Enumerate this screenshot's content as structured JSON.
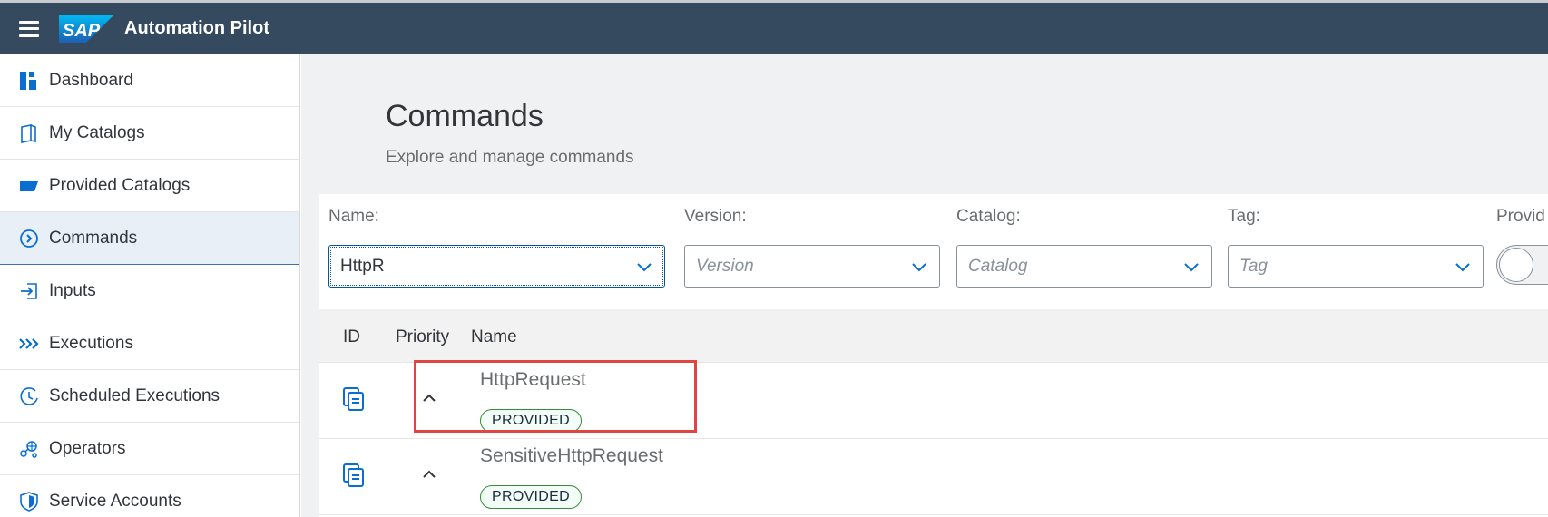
{
  "shell": {
    "title": "Automation Pilot",
    "logo_text": "SAP"
  },
  "nav": [
    {
      "label": "Dashboard",
      "icon": "dashboard-icon"
    },
    {
      "label": "My Catalogs",
      "icon": "catalog-book-icon"
    },
    {
      "label": "Provided Catalogs",
      "icon": "provided-catalog-icon"
    },
    {
      "label": "Commands",
      "icon": "command-circle-icon",
      "active": true
    },
    {
      "label": "Inputs",
      "icon": "input-arrow-icon"
    },
    {
      "label": "Executions",
      "icon": "executions-chevrons-icon"
    },
    {
      "label": "Scheduled Executions",
      "icon": "scheduled-clock-icon"
    },
    {
      "label": "Operators",
      "icon": "operators-network-icon"
    },
    {
      "label": "Service Accounts",
      "icon": "service-account-shield-icon"
    }
  ],
  "page": {
    "title": "Commands",
    "subtitle": "Explore and manage commands"
  },
  "filters": {
    "name": {
      "label": "Name:",
      "value": "HttpR"
    },
    "version": {
      "label": "Version:",
      "placeholder": "Version"
    },
    "catalog": {
      "label": "Catalog:",
      "placeholder": "Catalog"
    },
    "tag": {
      "label": "Tag:",
      "placeholder": "Tag"
    },
    "provided": {
      "label": "Provid"
    }
  },
  "table": {
    "columns": {
      "id": "ID",
      "priority": "Priority",
      "name": "Name"
    },
    "rows": [
      {
        "name": "HttpRequest",
        "badge": "PROVIDED"
      },
      {
        "name": "SensitiveHttpRequest",
        "badge": "PROVIDED"
      }
    ]
  },
  "colors": {
    "shell": "#354a5f",
    "accent": "#0a6ed1",
    "highlight": "#e0463d",
    "badge_border": "#3a8a3a"
  }
}
